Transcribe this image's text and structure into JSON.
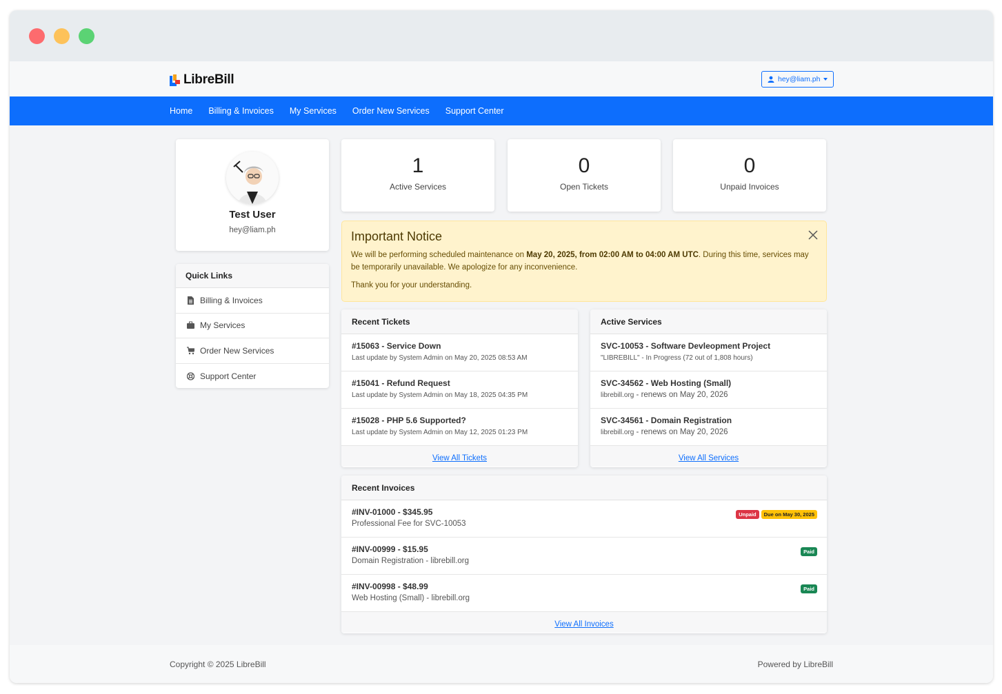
{
  "brand": {
    "name": "LibreBill"
  },
  "user_menu": {
    "label": "hey@liam.ph",
    "icon": "user-icon"
  },
  "nav": [
    "Home",
    "Billing & Invoices",
    "My Services",
    "Order New Services",
    "Support Center"
  ],
  "profile": {
    "name": "Test User",
    "email": "hey@liam.ph"
  },
  "quick_links": {
    "title": "Quick Links",
    "items": [
      {
        "label": "Billing & Invoices",
        "icon": "file-invoice-icon"
      },
      {
        "label": "My Services",
        "icon": "briefcase-icon"
      },
      {
        "label": "Order New Services",
        "icon": "cart-icon"
      },
      {
        "label": "Support Center",
        "icon": "lifebuoy-icon"
      }
    ]
  },
  "stats": [
    {
      "value": "1",
      "label": "Active Services"
    },
    {
      "value": "0",
      "label": "Open Tickets"
    },
    {
      "value": "0",
      "label": "Unpaid Invoices"
    }
  ],
  "notice": {
    "title": "Important Notice",
    "text_before": "We will be performing scheduled maintenance on ",
    "text_bold": "May 20, 2025, from 02:00 AM to 04:00 AM UTC",
    "text_after": ". During this time, services may be temporarily unavailable. We apologize for any inconvenience.",
    "thanks": "Thank you for your understanding."
  },
  "tickets": {
    "title": "Recent Tickets",
    "items": [
      {
        "title": "#15063 - Service Down",
        "sub": "Last update by System Admin on May 20, 2025 08:53 AM"
      },
      {
        "title": "#15041 - Refund Request",
        "sub": "Last update by System Admin on May 18, 2025 04:35 PM"
      },
      {
        "title": "#15028 - PHP 5.6 Supported?",
        "sub": "Last update by System Admin on May 12, 2025 01:23 PM"
      }
    ],
    "view_all": "View All Tickets"
  },
  "services": {
    "title": "Active Services",
    "items": [
      {
        "title": "SVC-10053 - Software Devleopment Project",
        "sub_a": "\"LIBREBILL\" - In Progress (72 out of 1,808 hours)",
        "sub_b": ""
      },
      {
        "title": "SVC-34562 - Web Hosting (Small)",
        "sub_a": "librebill.org",
        "sub_b": " - renews on May 20, 2026"
      },
      {
        "title": "SVC-34561 - Domain Registration",
        "sub_a": "librebill.org",
        "sub_b": " - renews on May 20, 2026"
      }
    ],
    "view_all": "View All Services"
  },
  "invoices": {
    "title": "Recent Invoices",
    "items": [
      {
        "title": "#INV-01000 - $345.95",
        "sub": "Professional Fee for SVC-10053",
        "badges": [
          "Unpaid",
          "Due on May 30, 2025"
        ]
      },
      {
        "title": "#INV-00999 - $15.95",
        "sub": "Domain Registration - librebill.org",
        "badges": [
          "Paid"
        ]
      },
      {
        "title": "#INV-00998 - $48.99",
        "sub": "Web Hosting (Small) - librebill.org",
        "badges": [
          "Paid"
        ]
      }
    ],
    "view_all": "View All Invoices"
  },
  "footer": {
    "copyright": "Copyright © 2025 LibreBill",
    "powered_prefix": "Powered by",
    "powered_brand": "LibreBill"
  },
  "colors": {
    "primary": "#0d6efd",
    "notice_bg": "#fff3cd",
    "unpaid": "#dc3545",
    "due": "#ffc107",
    "paid": "#198754"
  }
}
